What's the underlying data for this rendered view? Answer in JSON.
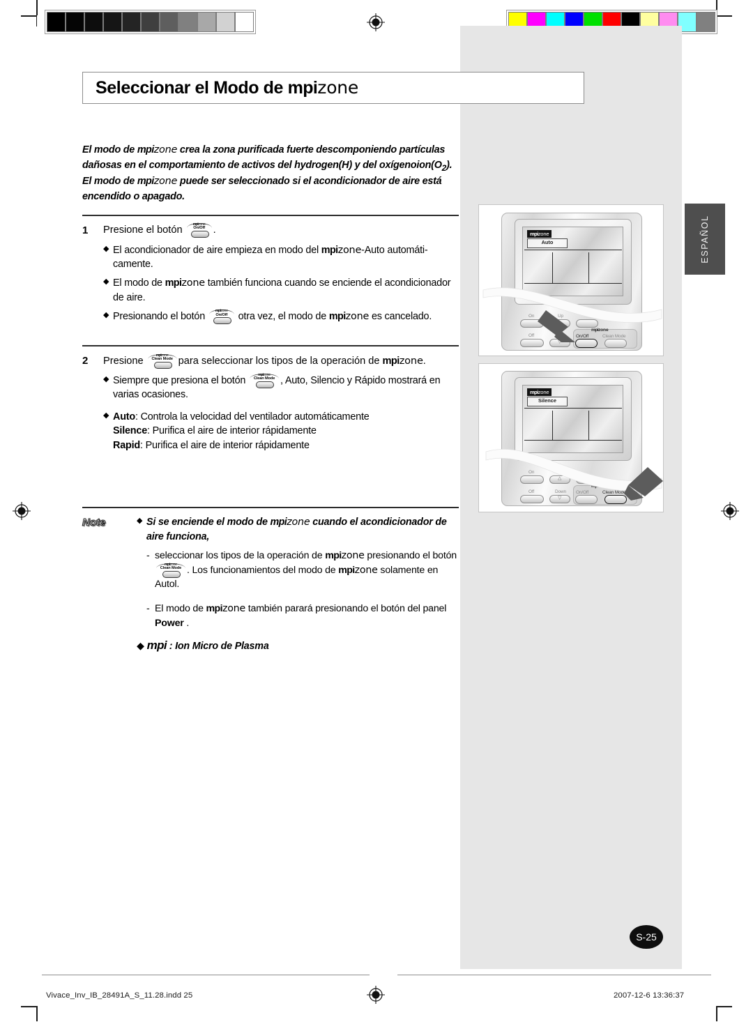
{
  "page": {
    "title_prefix": "Seleccionar el Modo de ",
    "brand_mpi": "mpi",
    "brand_zone": "zone",
    "language_tab": "ESPAÑOL",
    "page_number": "S-25"
  },
  "intro": {
    "line1_a": "El modo de ",
    "line1_b": " crea la zona purificada fuerte descomponiendo partículas",
    "line2": "dañosas en el comportamiento de activos del hydrogen(H) y del oxígenoion(O",
    "line2_sub": "2",
    "line2_end": ").",
    "line3_a": "El modo de ",
    "line3_b": " puede ser seleccionado si el acondicionador de aire está",
    "line4": "encendido o apagado."
  },
  "step1": {
    "number": "1",
    "lead": "Presione el botón",
    "period": ".",
    "bullets": [
      {
        "pre": "El acondicionador de aire empieza en modo del ",
        "post": "-Auto automáti-camente."
      },
      {
        "pre": "El modo de ",
        "post": " también funciona cuando se enciende el acondicionador de aire."
      },
      {
        "pre": "Presionando el botón ",
        "mid": " otra vez, el modo de ",
        "post": " es cancelado."
      }
    ]
  },
  "step2": {
    "number": "2",
    "lead": "Presione",
    "lead_tail_pre": "para seleccionar los tipos de la operación de ",
    "lead_tail_post": ".",
    "bullet1_pre": "Siempre que presiona el botón ",
    "bullet1_post": ", Auto, Silencio y Rápido mostrará en varias ocasiones.",
    "modes": [
      {
        "name": "Auto",
        "desc": ": Controla la velocidad del ventilador automáticamente"
      },
      {
        "name": "Silence",
        "desc": ": Purifica el aire de interior rápidamente"
      },
      {
        "name": "Rapid",
        "desc": ": Purifica el aire de interior rápidamente"
      }
    ]
  },
  "note": {
    "label": "Note",
    "head_pre": "Si se enciende el modo de ",
    "head_post": " cuando el acondicionador de aire funciona,",
    "dash1_pre": "seleccionar los tipos de la operación de ",
    "dash1_mid": " presionando el botón ",
    "dash1_mid2": ". Los funcionamientos del modo de ",
    "dash1_post": " solamente en Autol.",
    "dash2_pre": "El modo de ",
    "dash2_mid": " también parará presionando el botón del panel ",
    "dash2_bold": "Power",
    "dash2_post": " .",
    "definition_post": " : Ion Micro de Plasma"
  },
  "buttons": {
    "onoff_arc_mpi": "mpi",
    "onoff_arc_zone": "zone",
    "onoff_label": "On/Off",
    "cleanmode_arc_mpi": "mpi",
    "cleanmode_arc_zone": "zone",
    "cleanmode_label": "Clean Mode"
  },
  "illustration1": {
    "lcd_tag_mpi": "mpi",
    "lcd_tag_zone": "zone",
    "lcd_mode": "Auto",
    "keys": [
      "On",
      "Up",
      "Off",
      "Down"
    ],
    "group_label_mpi": "mpi",
    "group_label_zone": "zone",
    "key_onoff": "On/Off",
    "key_cleanmode": "Clean Mode",
    "highlighted_key": "On/Off"
  },
  "illustration2": {
    "lcd_tag_mpi": "mpi",
    "lcd_tag_zone": "zone",
    "lcd_mode": "Silence",
    "keys": [
      "On",
      "Up",
      "Off",
      "Down"
    ],
    "group_label_mpi": "mpi",
    "group_label_zone": "zone",
    "key_onoff": "On/Off",
    "key_cleanmode": "Clean Mode",
    "highlighted_key": "Clean Mode"
  },
  "footer": {
    "filename": "Vivace_Inv_IB_28491A_S_11.28.indd   25",
    "timestamp": "2007-12-6    13:36:37"
  },
  "calibration": {
    "grayscale": [
      "#000000",
      "#050505",
      "#0d0d0d",
      "#151515",
      "#242424",
      "#3f3f3f",
      "#5e5e5e",
      "#808080",
      "#a8a8a8",
      "#d2d2d2",
      "#ffffff"
    ],
    "colors": [
      "#ffff00",
      "#ff00ff",
      "#00ffff",
      "#0000ff",
      "#00e000",
      "#ff0000",
      "#000000",
      "#ffffa0",
      "#ff8cf0",
      "#80ffff",
      "#808080"
    ]
  }
}
